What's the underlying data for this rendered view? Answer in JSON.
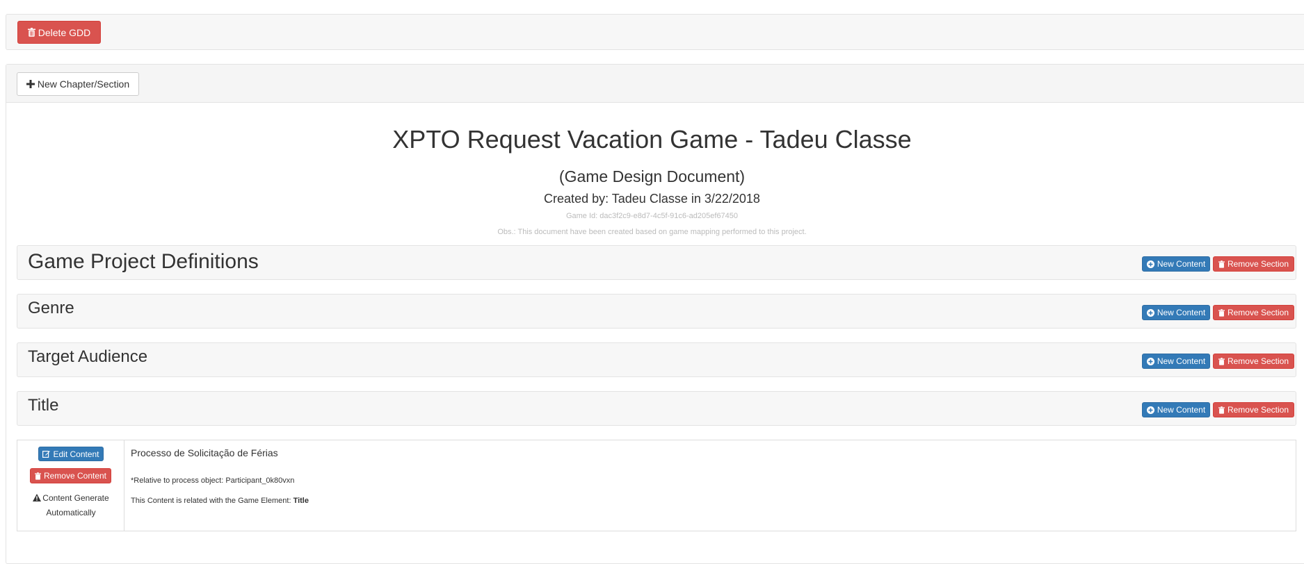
{
  "top_bar": {
    "delete_gdd_label": "Delete GDD"
  },
  "main": {
    "new_chapter_label": "New Chapter/Section",
    "title": "XPTO Request Vacation Game - Tadeu Classe",
    "subtitle": "(Game Design Document)",
    "created_by": "Created by: Tadeu Classe in 3/22/2018",
    "game_id": "Game Id: dac3f2c9-e8d7-4c5f-91c6-ad205ef67450",
    "obs": "Obs.: This document have been created based on game mapping performed to this project."
  },
  "sections": [
    {
      "title": "Game Project Definitions",
      "new_content_label": "New Content",
      "remove_section_label": "Remove Section"
    },
    {
      "title": "Genre",
      "new_content_label": "New Content",
      "remove_section_label": "Remove Section"
    },
    {
      "title": "Target Audience",
      "new_content_label": "New Content",
      "remove_section_label": "Remove Section"
    },
    {
      "title": "Title",
      "new_content_label": "New Content",
      "remove_section_label": "Remove Section"
    }
  ],
  "content": {
    "edit_label": "Edit Content",
    "remove_label": "Remove Content",
    "auto_line1": "Content Generate",
    "auto_line2": "Automatically",
    "text": "Processo de Solicitação de Férias",
    "relative": "*Relative to process object: Participant_0k80vxn",
    "related_prefix": "This Content is related with the Game Element: ",
    "related_element": "Title"
  },
  "colors": {
    "danger": "#d9534f",
    "primary": "#337ab7",
    "panel": "#f7f7f7"
  },
  "icons": {
    "trash": "trash-icon",
    "plus": "plus-icon",
    "plus_circle": "plus-circle-icon",
    "edit": "edit-icon",
    "warning": "warning-icon"
  }
}
